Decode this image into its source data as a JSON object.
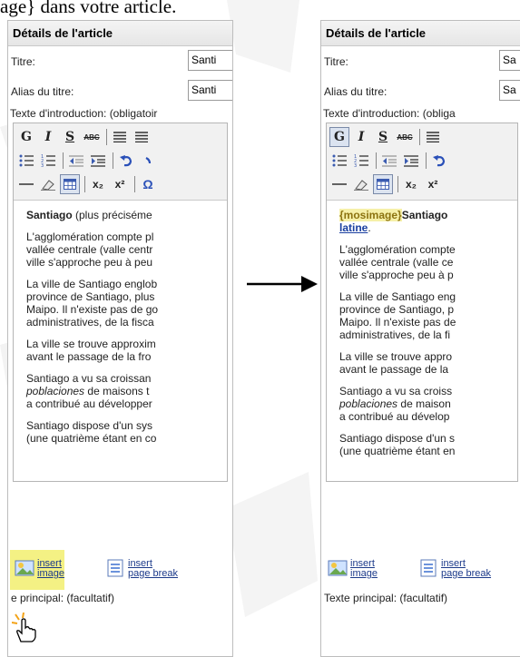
{
  "caption": "age} dans votre article.",
  "left": {
    "header": "Détails de l'article",
    "title_label": "Titre:",
    "title_value": "Santi",
    "alias_label": "Alias du titre:",
    "alias_value": "Santi",
    "intro_label": "Texte d'introduction: (obligatoir",
    "content": {
      "p1_bold": "Santiago",
      "p1_rest": " (plus précisémе",
      "p2": "L'agglomération compte pl\nvallée centrale (valle centr\nville s'approche peu à peu",
      "p3": "La ville de Santiago englob\nprovince de Santiago, plus\nMaipo. Il n'existe pas de go\nadministratives, de la fisca",
      "p4": "La ville se trouve approxim\navant le passage de la fro",
      "p5a": "Santiago a vu sa croissan",
      "p5b_italic": "poblaciones",
      "p5c": " de maisons t\na contribué au développer",
      "p6": "Santiago dispose d'un sys\n(une quatrième étant en co"
    },
    "insert_image_1": "insert",
    "insert_image_2": "image",
    "page_break_1": "insert",
    "page_break_2": "page break",
    "principal": "e principal: (facultatif)"
  },
  "right": {
    "header": "Détails de l'article",
    "title_label": "Titre:",
    "title_value": "Sa",
    "alias_label": "Alias du titre:",
    "alias_value": "Sa",
    "intro_label": "Texte d'introduction: (obliga",
    "content": {
      "p1_tag": "{mosimage}",
      "p1_bold": "Santiago",
      "p1_link": "latine",
      "p2": "L'agglomération compte\nvallée centrale (valle ce\nville s'approche peu à p",
      "p3": "La ville de Santiago eng\nprovince de Santiago, p\nMaipo. Il n'existe pas de\nadministratives, de la fi",
      "p4": "La ville se trouve appro\navant le passage de la",
      "p5a": "Santiago a vu sa croiss",
      "p5b_italic": "poblaciones",
      "p5c": " de maison\na contribué au dévelop",
      "p6": "Santiago dispose d'un s\n(une quatrième étant en"
    },
    "insert_image_1": "insert",
    "insert_image_2": "image",
    "page_break_1": "insert",
    "page_break_2": "page break",
    "principal": "Texte principal: (facultatif)"
  },
  "toolbar": {
    "bold": "G",
    "italic": "I",
    "underline": "S",
    "strike": "ABC",
    "sub": "x₂",
    "sup": "x²"
  },
  "colors": {
    "highlight": "#f2ef6e",
    "link": "#1a3fa0",
    "tag": "#8c7310"
  }
}
